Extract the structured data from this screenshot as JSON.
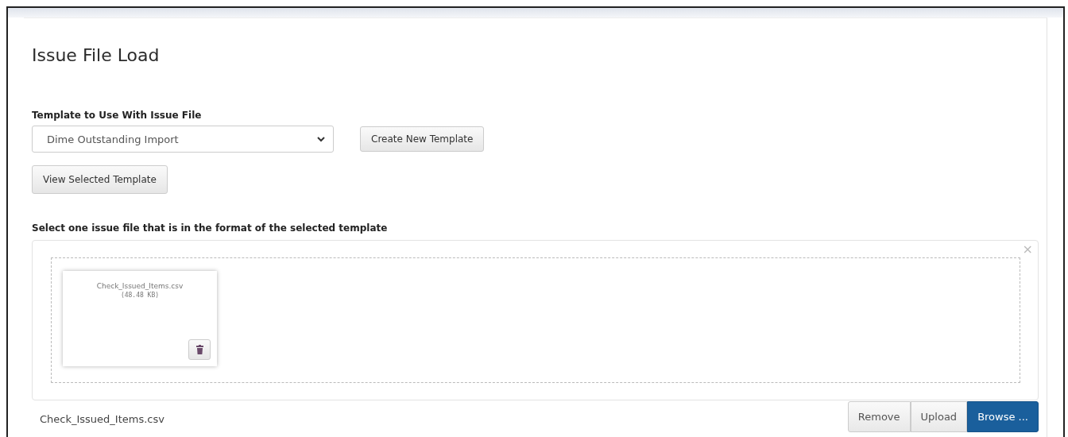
{
  "title": "Issue File Load",
  "template_field": {
    "label": "Template to Use With Issue File",
    "value": "Dime Outstanding Import"
  },
  "create_button": "Create New Template",
  "view_button": "View Selected Template",
  "file_prompt": "Select one issue file that is in the format of the selected template",
  "dropzone": {
    "close": "×",
    "previews": [
      {
        "name": "Check_Issued_Items.csv",
        "size": "(48.48 KB)"
      }
    ]
  },
  "caption": "Check_Issued_Items.csv",
  "actions": [
    {
      "label": "Remove",
      "kind": "default"
    },
    {
      "label": "Upload",
      "kind": "default"
    },
    {
      "label": "Browse ...",
      "kind": "primary"
    }
  ]
}
